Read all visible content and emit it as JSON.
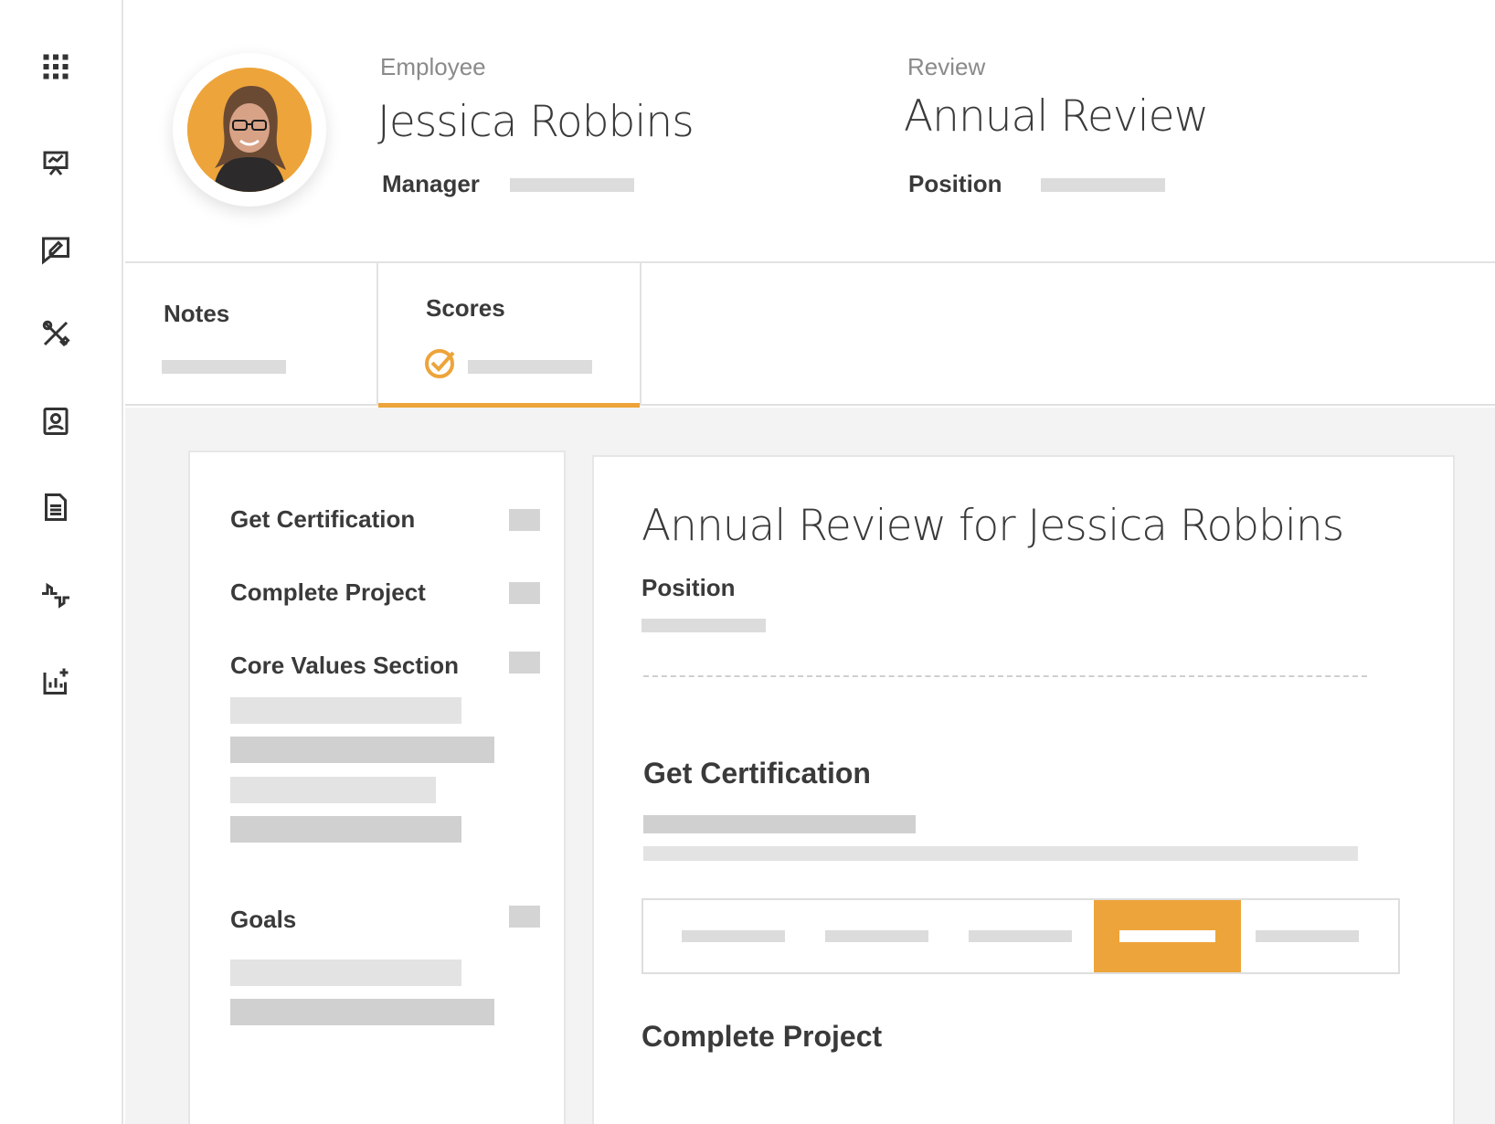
{
  "sidebar": {
    "items": [
      {
        "icon": "apps-grid-icon"
      },
      {
        "icon": "presentation-icon"
      },
      {
        "icon": "feedback-chat-icon"
      },
      {
        "icon": "tools-icon"
      },
      {
        "icon": "profile-card-icon"
      },
      {
        "icon": "document-icon"
      },
      {
        "icon": "thumbs-up-down-icon"
      },
      {
        "icon": "chart-add-icon"
      }
    ]
  },
  "header": {
    "employee_label": "Employee",
    "employee_name": "Jessica Robbins",
    "manager_label": "Manager",
    "review_label": "Review",
    "review_name": "Annual Review",
    "position_label": "Position"
  },
  "tabs": [
    {
      "label": "Notes",
      "active": false
    },
    {
      "label": "Scores",
      "active": true,
      "icon": "check-circle-icon"
    }
  ],
  "left_panel": {
    "items": [
      {
        "label": "Get Certification"
      },
      {
        "label": "Complete Project"
      },
      {
        "label": "Core Values Section"
      },
      {
        "label": "Goals"
      }
    ]
  },
  "main_panel": {
    "title": "Annual Review for Jessica Robbins",
    "position_label": "Position",
    "sections": [
      {
        "title": "Get Certification",
        "rating_options": 5,
        "selected_option": 4
      },
      {
        "title": "Complete Project"
      }
    ]
  },
  "colors": {
    "accent": "#eda43a",
    "placeholder": "#dcdcdc",
    "text": "#3a3a3a"
  }
}
